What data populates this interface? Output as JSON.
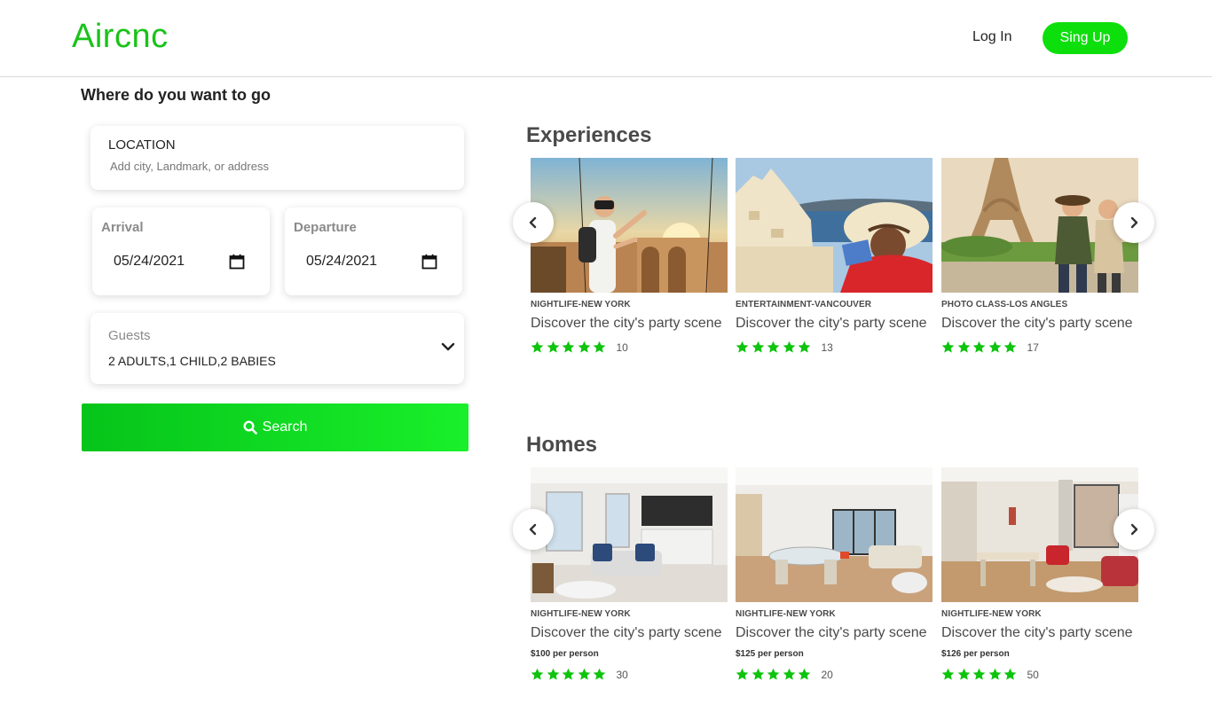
{
  "header": {
    "logo": "Aircnc",
    "login_label": "Log In",
    "signup_label": "Sing Up"
  },
  "search_panel": {
    "heading": "Where do you want to go",
    "location_label": "LOCATION",
    "location_placeholder": "Add city, Landmark, or address",
    "arrival_label": "Arrival",
    "arrival_value": "05/24/2021",
    "departure_label": "Departure",
    "departure_value": "05/24/2021",
    "guests_label": "Guests",
    "guests_value": "2 ADULTS,1 CHILD,2 BABIES",
    "search_label": "Search"
  },
  "experiences": {
    "title": "Experiences",
    "items": [
      {
        "category": "NIGHTLIFE-NEW YORK",
        "title": "Discover the city's party scene",
        "stars": 5,
        "count": "10"
      },
      {
        "category": "ENTERTAINMENT-VANCOUVER",
        "title": "Discover the city's party scene",
        "stars": 5,
        "count": "13"
      },
      {
        "category": "PHOTO CLASS-LOS ANGLES",
        "title": "Discover the city's party scene",
        "stars": 5,
        "count": "17"
      }
    ]
  },
  "homes": {
    "title": "Homes",
    "items": [
      {
        "category": "NIGHTLIFE-NEW YORK",
        "title": "Discover the city's party scene",
        "price": "$100 per person",
        "stars": 5,
        "count": "30"
      },
      {
        "category": "NIGHTLIFE-NEW YORK",
        "title": "Discover the city's party scene",
        "price": "$125 per person",
        "stars": 5,
        "count": "20"
      },
      {
        "category": "NIGHTLIFE-NEW YORK",
        "title": "Discover the city's party scene",
        "price": "$126 per person",
        "stars": 5,
        "count": "50"
      }
    ]
  },
  "colors": {
    "brand_green": "#1ac21a",
    "button_green": "#0ddf0d",
    "star_green": "#0ec40e"
  },
  "icons": {
    "calendar": "calendar-icon",
    "chevron_down": "chevron-down-icon",
    "search": "search-icon",
    "star": "star-icon",
    "prev": "chevron-left-icon",
    "next": "chevron-right-icon"
  }
}
